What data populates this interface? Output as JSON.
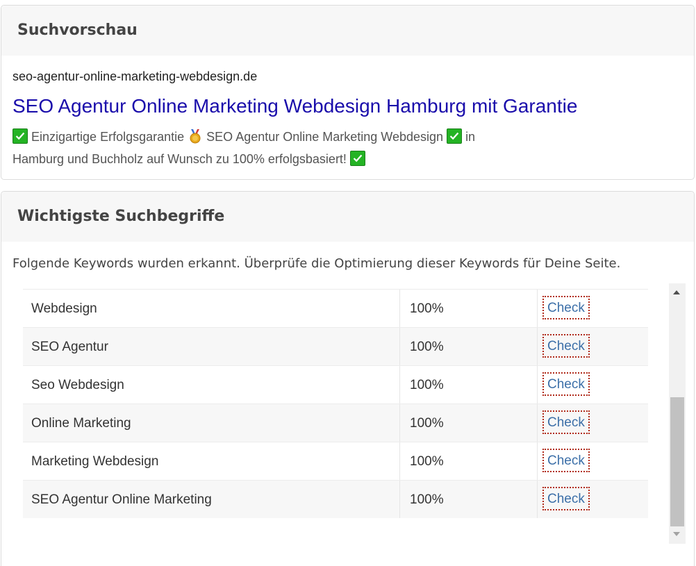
{
  "preview": {
    "heading": "Suchvorschau",
    "url": "seo-agentur-online-marketing-webdesign.de",
    "title": "SEO Agentur Online Marketing Webdesign Hamburg mit Garantie",
    "desc_part1": "Einzigartige Erfolgsgarantie",
    "desc_part2": "SEO Agentur Online Marketing Webdesign",
    "desc_part3": "in",
    "desc_part4": "Hamburg und Buchholz auf Wunsch zu 100% erfolgsbasiert!"
  },
  "keywords": {
    "heading": "Wichtigste Suchbegriffe",
    "intro": "Folgende Keywords wurden erkannt. Überprüfe die Optimierung dieser Keywords für Deine Seite.",
    "check_label": "Check",
    "rows": [
      {
        "keyword": "Webdesign",
        "percent": "100%"
      },
      {
        "keyword": "SEO Agentur",
        "percent": "100%"
      },
      {
        "keyword": "Seo Webdesign",
        "percent": "100%"
      },
      {
        "keyword": "Online Marketing",
        "percent": "100%"
      },
      {
        "keyword": "Marketing Webdesign",
        "percent": "100%"
      },
      {
        "keyword": "SEO Agentur Online Marketing",
        "percent": "100%"
      }
    ]
  },
  "icons": {
    "check": "green-check-emoji-icon",
    "medal": "medal-emoji-icon"
  },
  "colors": {
    "title_link": "#1a0dab",
    "check_link": "#3c6fa8",
    "check_border": "#b02a1a",
    "emoji_green": "#24b324"
  }
}
